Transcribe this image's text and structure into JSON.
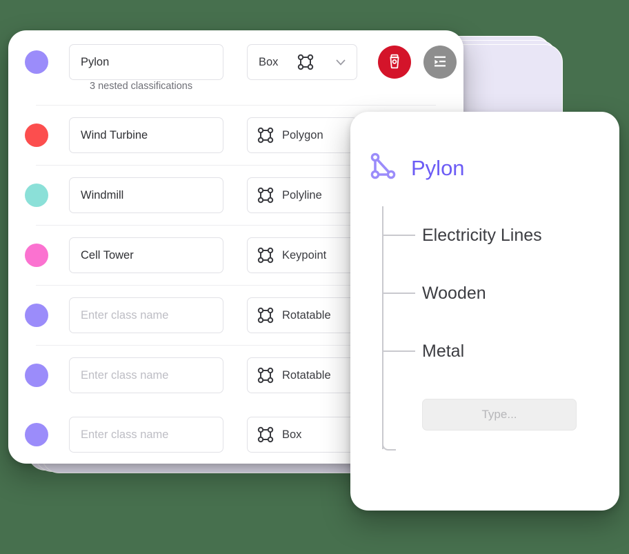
{
  "theme": {
    "background": "#47704E",
    "card_background": "#FFFFFF",
    "ghost_card": "#E9E6F6",
    "accent_purple": "#6C5CF5",
    "delete_red": "#D4142A",
    "nest_gray": "#8E8E8E",
    "divider": "#EDEDF0",
    "tree_line": "#C9C9CE"
  },
  "class_list": {
    "rows": [
      {
        "color": "#9B8CFA",
        "name_value": "Pylon",
        "name_placeholder": "Enter class name",
        "shape_label": "Box",
        "shape_icon": "bounding-box-icon",
        "icon_position": "right",
        "has_dropdown": true,
        "dropdown_icon": "chevron-down-icon",
        "delete_label": "",
        "delete_icon": "trash-icon",
        "nest_icon": "nest-indent-icon",
        "note": "3 nested classifications",
        "divider_after": true
      },
      {
        "color": "#FC4E4E",
        "name_value": "Wind Turbine",
        "name_placeholder": "Enter class name",
        "shape_label": "Polygon",
        "shape_icon": "bounding-box-icon",
        "icon_position": "left",
        "has_dropdown": false,
        "divider_after": true
      },
      {
        "color": "#8BE0D8",
        "name_value": "Windmill",
        "name_placeholder": "Enter class name",
        "shape_label": "Polyline",
        "shape_icon": "bounding-box-icon",
        "icon_position": "left",
        "has_dropdown": false,
        "divider_after": true
      },
      {
        "color": "#FB72D0",
        "name_value": "Cell Tower",
        "name_placeholder": "Enter class name",
        "shape_label": "Keypoint",
        "shape_icon": "bounding-box-icon",
        "icon_position": "left",
        "has_dropdown": false,
        "divider_after": true
      },
      {
        "color": "#9B8CFA",
        "name_value": "",
        "name_placeholder": "Enter class name",
        "shape_label": "Rotatable",
        "shape_icon": "bounding-box-icon",
        "icon_position": "left",
        "has_dropdown": false,
        "divider_after": true
      },
      {
        "color": "#9B8CFA",
        "name_value": "",
        "name_placeholder": "Enter class name",
        "shape_label": "Rotatable",
        "shape_icon": "bounding-box-icon",
        "icon_position": "left",
        "has_dropdown": false,
        "divider_after": false
      },
      {
        "color": "#9B8CFA",
        "name_value": "",
        "name_placeholder": "Enter class name",
        "shape_label": "Box",
        "shape_icon": "bounding-box-icon",
        "icon_position": "left",
        "has_dropdown": false,
        "divider_after": false
      }
    ]
  },
  "detail_panel": {
    "icon": "polygon-triangle-icon",
    "title": "Pylon",
    "nested": [
      {
        "label": "Electricity Lines"
      },
      {
        "label": "Wooden"
      },
      {
        "label": "Metal"
      }
    ],
    "new_input_placeholder": "Type..."
  }
}
